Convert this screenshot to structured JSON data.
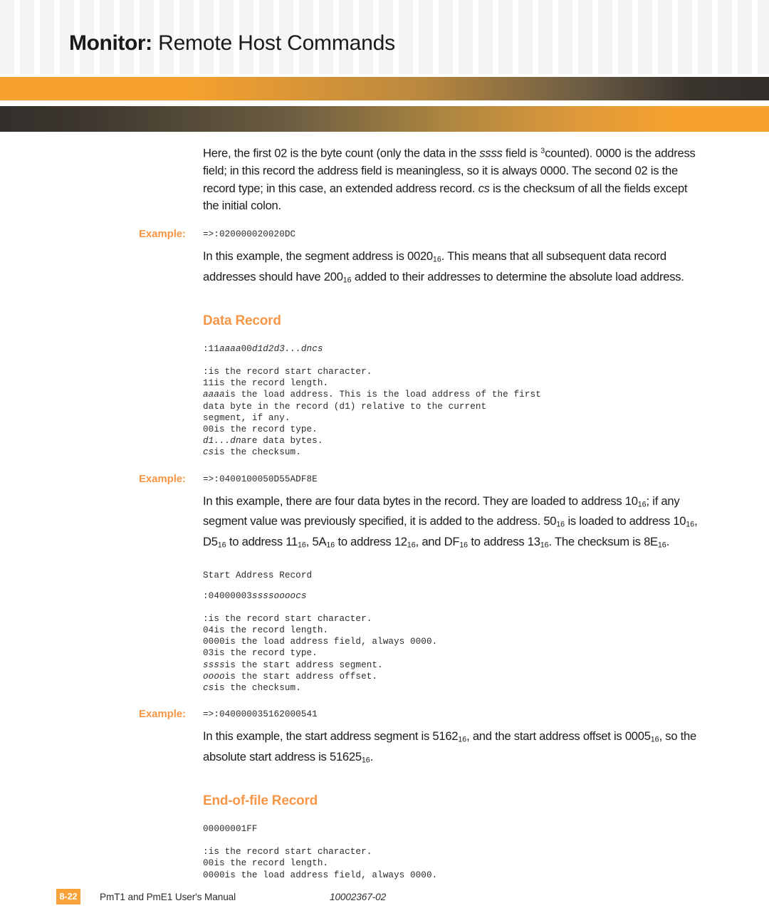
{
  "header": {
    "title_bold": "Monitor:",
    "title_regular": "Remote Host Commands",
    "accent_orange": "#f7a22e",
    "bar_dark": "#332e2a"
  },
  "content": {
    "intro_paragraph": {
      "p1": "Here, the first 02 is the byte count (only the data in the ",
      "ssss": "ssss",
      "p2": " field is ",
      "sup3": "3",
      "p3": "counted). 0000 is the address field; in this record the address field is meaningless, so it is always 0000. The second 02 is the record type; in this case, an extended address record. ",
      "cs": "cs",
      "p4": " is the checksum of all the fields except the initial colon."
    },
    "example1": {
      "label": "Example:",
      "code": "=>:020000020020DC"
    },
    "segment_paragraph": {
      "p1": "In this example, the segment address is 0020",
      "sub1": "16",
      "p2": ". This means that all subsequent data record addresses should have 200",
      "sub2": "16",
      "p3": " added to their addresses to determine the absolute load address."
    },
    "data_record": {
      "heading": "Data Record",
      "format_prefix": ":11",
      "format_aaaa": "aaaa",
      "format_mid": "00",
      "format_d": "d1d2d3...dn",
      "format_cs": "cs",
      "defs": [
        {
          "term": ":",
          "term_italic": false,
          "desc": "is the record start character."
        },
        {
          "term": "11",
          "term_italic": false,
          "desc": "is the record length."
        },
        {
          "term": "aaaa",
          "term_italic": true,
          "desc": "is the load address. This is the load address of the first\ndata byte in the record (d1) relative to the current\nsegment, if any."
        },
        {
          "term": "00",
          "term_italic": false,
          "desc": "is the record type."
        },
        {
          "term": "d1...dn",
          "term_italic": true,
          "desc": "are data bytes."
        },
        {
          "term": "cs",
          "term_italic": true,
          "desc": "is the checksum."
        }
      ]
    },
    "example2": {
      "label": "Example:",
      "code": "=>:0400100050D55ADF8E"
    },
    "data_paragraph": {
      "p1": "In this example, there are four data bytes in the record. They are loaded to address 10",
      "sub1": "16",
      "p2": "; if any segment value was previously specified, it is added to the address. 50",
      "sub2": "16",
      "p3": " is loaded to address 10",
      "sub3": "16",
      "p4": ", D5",
      "sub4": "16",
      "p5": " to address 11",
      "sub5": "16",
      "p6": ", 5A",
      "sub6": "16",
      "p7": " to address 12",
      "sub7": "16",
      "p8": ", and DF",
      "sub8": "16",
      "p9": " to address 13",
      "sub9": "16",
      "p10": ". The checksum is 8E",
      "sub10": "16",
      "p11": "."
    },
    "start_address_record": {
      "heading": "Start Address Record",
      "format_prefix": ":04000003",
      "format_ssss": "ssss",
      "format_oooo": "oooo",
      "format_cs": "cs",
      "defs": [
        {
          "term": ":",
          "term_italic": false,
          "desc": "is the record start character."
        },
        {
          "term": "04",
          "term_italic": false,
          "desc": "is the record length."
        },
        {
          "term": "0000",
          "term_italic": false,
          "desc": "is the load address field, always 0000."
        },
        {
          "term": "03",
          "term_italic": false,
          "desc": "is the record type."
        },
        {
          "term": "ssss",
          "term_italic": true,
          "desc": "is the start address segment."
        },
        {
          "term": "oooo",
          "term_italic": true,
          "desc": "is the start address offset."
        },
        {
          "term": "cs",
          "term_italic": true,
          "desc": "is the checksum."
        }
      ]
    },
    "example3": {
      "label": "Example:",
      "code": "=>:040000035162000541"
    },
    "start_paragraph": {
      "p1": "In this example, the start address segment is 5162",
      "sub1": "16",
      "p2": ", and the start address offset is 0005",
      "sub2": "16",
      "p3": ", so the absolute start address is 51625",
      "sub3": "16",
      "p4": "."
    },
    "eof_record": {
      "heading": "End-of-file Record",
      "format": "00000001FF",
      "defs": [
        {
          "term": ":",
          "term_italic": false,
          "desc": "is the record start character."
        },
        {
          "term": "00",
          "term_italic": false,
          "desc": "is the record length."
        },
        {
          "term": "0000",
          "term_italic": false,
          "desc": "is the load address field, always 0000."
        }
      ]
    }
  },
  "footer": {
    "page_number": "8-22",
    "manual_name": "PmT1 and PmE1 User's Manual",
    "document_number": "10002367-02"
  }
}
